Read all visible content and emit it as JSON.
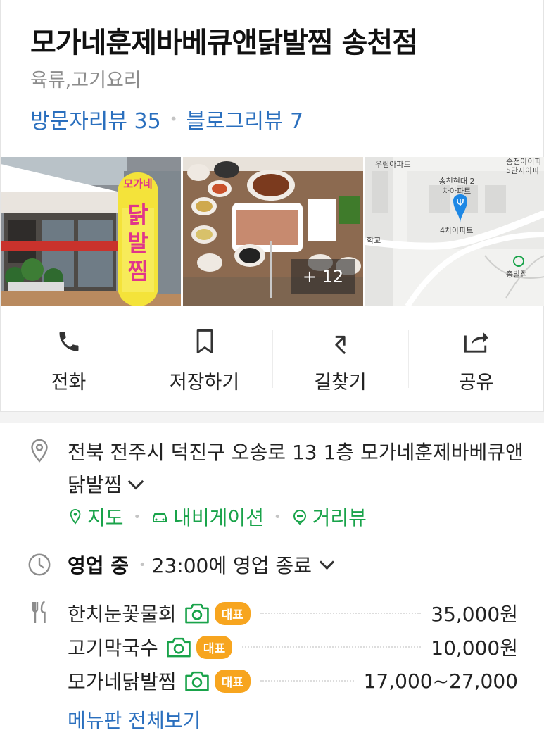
{
  "place": {
    "title": "모가네훈제바베큐앤닭발찜 송천점",
    "category": "육류,고기요리",
    "visitor_reviews": "방문자리뷰 35",
    "blog_reviews": "블로그리뷰 7"
  },
  "photos": {
    "more_count": "+ 12",
    "storefront_sign": "모가네 닭발찜",
    "map_labels": [
      "우림아파트",
      "송천아이파 5단지아파",
      "송천현대 2차아파트",
      "4차아파트",
      "학교",
      "송천",
      "총발점"
    ]
  },
  "actions": [
    {
      "label": "전화",
      "icon": "phone-icon"
    },
    {
      "label": "저장하기",
      "icon": "bookmark-icon"
    },
    {
      "label": "길찾기",
      "icon": "directions-icon"
    },
    {
      "label": "공유",
      "icon": "share-icon"
    }
  ],
  "address": {
    "text": "전북 전주시 덕진구 오송로 13 1층 모가네훈제바베큐앤닭발찜",
    "links": [
      "지도",
      "내비게이션",
      "거리뷰"
    ]
  },
  "hours": {
    "status": "영업 중",
    "detail": "23:00에 영업 종료"
  },
  "menu": {
    "items": [
      {
        "name": "한치눈꽃물회",
        "badge": "대표",
        "price": "35,000원"
      },
      {
        "name": "고기막국수",
        "badge": "대표",
        "price": "10,000원"
      },
      {
        "name": "모가네닭발찜",
        "badge": "대표",
        "price": "17,000~27,000"
      }
    ],
    "view_all": "메뉴판 전체보기"
  },
  "colors": {
    "link_blue": "#2a6fbe",
    "nav_green": "#19a34a",
    "badge_orange": "#f7a51f",
    "map_pin_blue": "#1e88e5"
  }
}
